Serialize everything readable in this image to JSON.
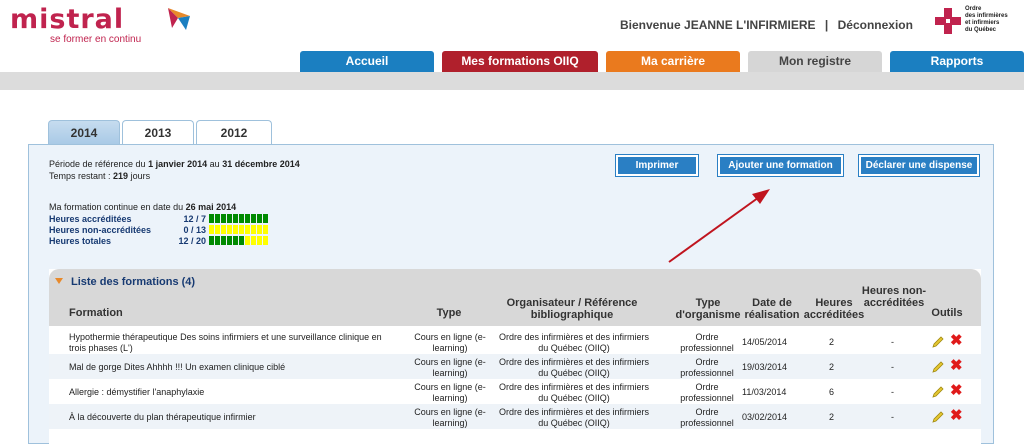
{
  "header": {
    "logo_text": "mistral",
    "logo_tagline": "se former en continu",
    "welcome": "Bienvenue JEANNE L'INFIRMIERE",
    "separator": "|",
    "logout": "Déconnexion",
    "org_logo_lines": [
      "Ordre",
      "des infirmières",
      "et infirmiers",
      "du Québec"
    ]
  },
  "main_tabs": [
    {
      "label": "Accueil",
      "color": "#1b7fc1"
    },
    {
      "label": "Mes formations OIIQ",
      "color": "#b0202c"
    },
    {
      "label": "Ma carrière",
      "color": "#ea7a1e"
    },
    {
      "label": "Mon registre",
      "color": "#d6d6d6"
    },
    {
      "label": "Rapports",
      "color": "#1b7fc1"
    }
  ],
  "year_tabs": [
    "2014",
    "2013",
    "2012"
  ],
  "period": {
    "prefix": "Période de référence du",
    "start": "1 janvier 2014",
    "middle": "au",
    "end": "31 décembre 2014",
    "remaining_label": "Temps restant :",
    "remaining_value": "219",
    "remaining_unit": "jours"
  },
  "buttons": {
    "print": "Imprimer",
    "add": "Ajouter une formation",
    "exemption": "Déclarer une dispense"
  },
  "form_status": {
    "prefix": "Ma formation continue en date du",
    "date": "26 mai 2014"
  },
  "hours": [
    {
      "label": "Heures accréditées",
      "value": "12 / 7",
      "filled": 10,
      "total": 10,
      "fill_color": "#008a00",
      "empty_color": "#ffff00"
    },
    {
      "label": "Heures non-accréditées",
      "value": "0 / 13",
      "filled": 0,
      "total": 10,
      "fill_color": "#008a00",
      "empty_color": "#ffff00"
    },
    {
      "label": "Heures totales",
      "value": "12 / 20",
      "filled": 6,
      "total": 10,
      "fill_color": "#008a00",
      "empty_color": "#ffff00"
    }
  ],
  "list": {
    "title": "Liste des formations (4)",
    "columns": [
      "Formation",
      "Type",
      "Organisateur / Référence bibliographique",
      "Type d'organisme",
      "Date de réalisation",
      "Heures accréditées",
      "Heures non-accréditées",
      "Outils"
    ],
    "rows": [
      {
        "formation": "Hypothermie thérapeutique Des soins infirmiers et une surveillance clinique en trois phases (L')",
        "type": "Cours en ligne (e-learning)",
        "organisateur": "Ordre des infirmières et des infirmiers du Québec (OIIQ)",
        "organisme": "Ordre professionnel",
        "date": "14/05/2014",
        "accr": "2",
        "non_accr": "-"
      },
      {
        "formation": "Mal de gorge Dites Ahhhh !!! Un examen clinique ciblé",
        "type": "Cours en ligne (e-learning)",
        "organisateur": "Ordre des infirmières et des infirmiers du Québec (OIIQ)",
        "organisme": "Ordre professionnel",
        "date": "19/03/2014",
        "accr": "2",
        "non_accr": "-"
      },
      {
        "formation": "Allergie : démystifier l'anaphylaxie",
        "type": "Cours en ligne (e-learning)",
        "organisateur": "Ordre des infirmières et des infirmiers du Québec (OIIQ)",
        "organisme": "Ordre professionnel",
        "date": "11/03/2014",
        "accr": "6",
        "non_accr": "-"
      },
      {
        "formation": "À la découverte du plan thérapeutique infirmier",
        "type": "Cours en ligne (e-learning)",
        "organisateur": "Ordre des infirmières et des infirmiers du Québec (OIIQ)",
        "organisme": "Ordre professionnel",
        "date": "03/02/2014",
        "accr": "2",
        "non_accr": "-"
      }
    ]
  },
  "icons": {
    "edit": "pencil-icon",
    "delete": "close-icon",
    "collapse": "caret-down-icon"
  },
  "colors": {
    "brand": "#c0234e",
    "panel": "#ecf3fa",
    "button": "#2a7fc4",
    "arrow": "#c0141e"
  }
}
